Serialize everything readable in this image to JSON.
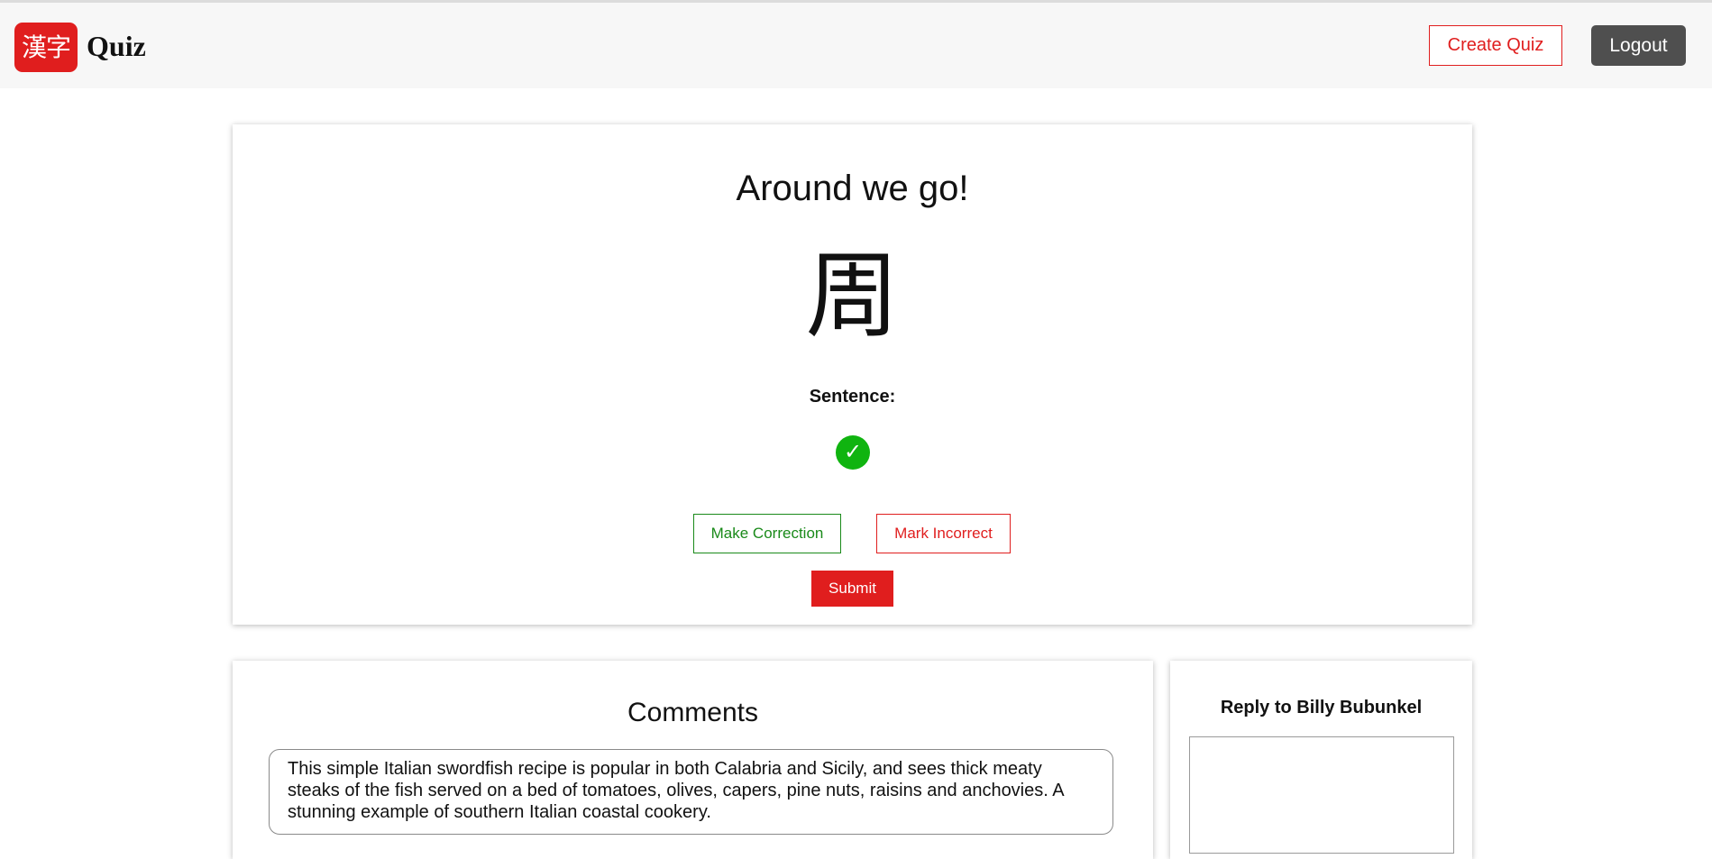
{
  "header": {
    "logo_kanji": "漢字",
    "logo_text": "Quiz",
    "create_quiz_label": "Create Quiz",
    "logout_label": "Logout"
  },
  "quiz": {
    "title": "Around we go!",
    "kanji": "周",
    "sentence_label": "Sentence:",
    "status_icon": "checkmark-circle-icon",
    "make_correction_label": "Make Correction",
    "mark_incorrect_label": "Mark Incorrect",
    "submit_label": "Submit"
  },
  "comments": {
    "title": "Comments",
    "items": [
      {
        "text": "This simple Italian swordfish recipe is popular in both Calabria and Sicily, and sees thick meaty steaks of the fish served on a bed of tomatoes, olives, capers, pine nuts, raisins and anchovies. A stunning example of southern Italian coastal cookery."
      }
    ]
  },
  "reply": {
    "title": "Reply to Billy Bubunkel",
    "value": ""
  },
  "colors": {
    "brand_red": "#e01e1e",
    "success_green": "#10b410",
    "dark_button": "#4f4f4f"
  }
}
